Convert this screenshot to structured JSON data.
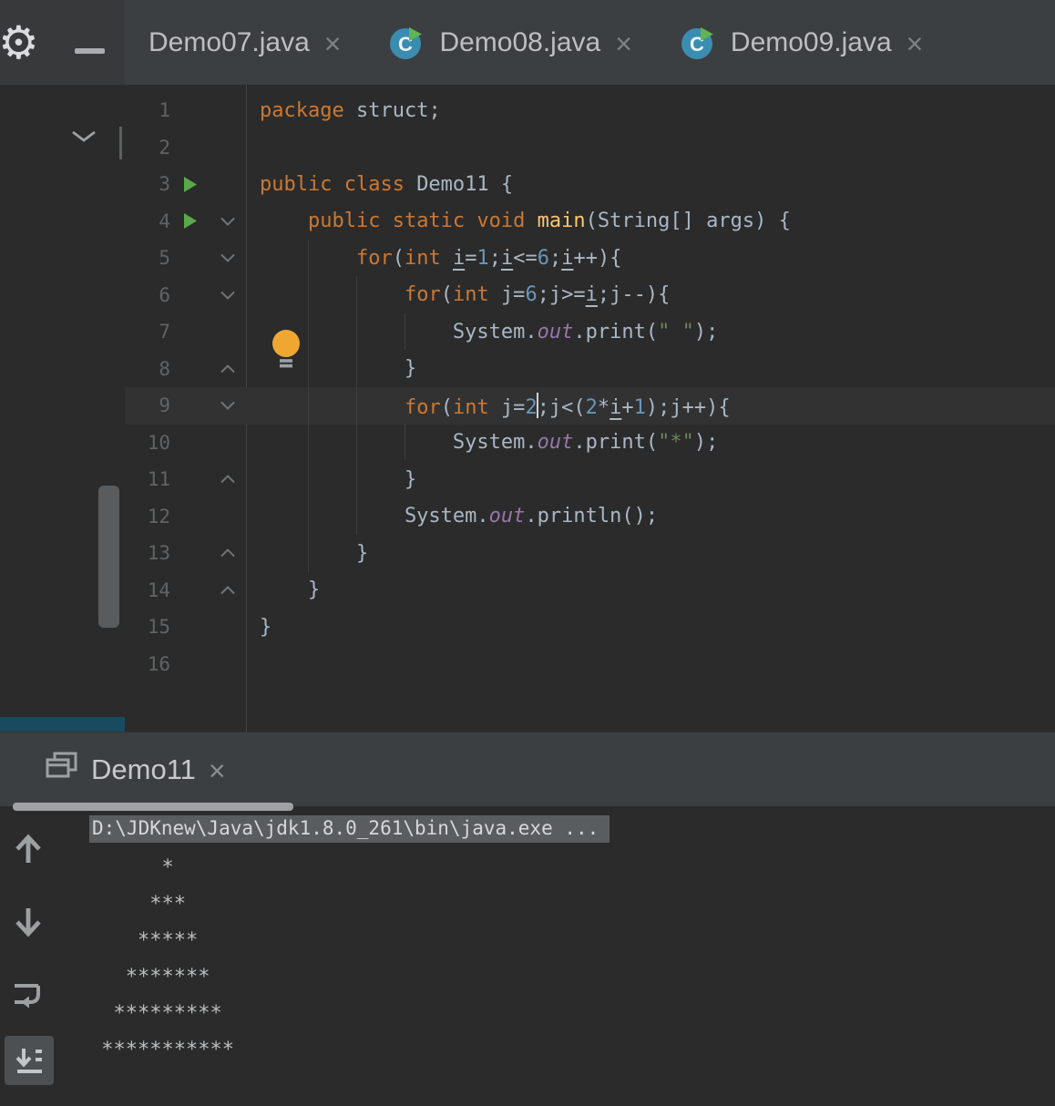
{
  "colors": {
    "keyword": "#cc7832",
    "plain": "#a9b7c6",
    "number": "#6897bb",
    "string": "#6a8759",
    "field": "#9876aa",
    "method": "#ffc66b",
    "line_number": "#606366",
    "editor_bg": "#2b2b2b",
    "caret_line_bg": "#323232",
    "tab_bar_bg": "#3c3f41",
    "panel_bg": "#3c3f41",
    "sidebar_accent": "#1a4a5f",
    "run_green": "#5ba74b",
    "class_icon_teal": "#3a8db0"
  },
  "titlebar": {
    "gear_glyph": "⚙"
  },
  "tabs": [
    {
      "label": "Demo07.java",
      "close_glyph": "×",
      "has_class_icon": false
    },
    {
      "label": "Demo08.java",
      "close_glyph": "×",
      "has_class_icon": true,
      "class_icon_letter": "C"
    },
    {
      "label": "Demo09.java",
      "close_glyph": "×",
      "has_class_icon": true,
      "class_icon_letter": "C"
    }
  ],
  "editor": {
    "lines": [
      {
        "n": 1,
        "t": [
          [
            "k",
            "package "
          ],
          [
            "p",
            "struct;"
          ]
        ]
      },
      {
        "n": 2,
        "t": []
      },
      {
        "n": 3,
        "run": true,
        "t": [
          [
            "k",
            "public class "
          ],
          [
            "p",
            "Demo11 {"
          ]
        ]
      },
      {
        "n": 4,
        "run": true,
        "fold": "down",
        "t": [
          [
            "p",
            "    "
          ],
          [
            "k",
            "public static void "
          ],
          [
            "m",
            "main"
          ],
          [
            "p",
            "(String[] args) {"
          ]
        ]
      },
      {
        "n": 5,
        "fold": "down",
        "t": [
          [
            "p",
            "        "
          ],
          [
            "k",
            "for"
          ],
          [
            "p",
            "("
          ],
          [
            "k",
            "int "
          ],
          [
            "u",
            "i"
          ],
          [
            "p",
            "="
          ],
          [
            "n",
            "1"
          ],
          [
            "p",
            ";"
          ],
          [
            "u",
            "i"
          ],
          [
            "p",
            "<="
          ],
          [
            "n",
            "6"
          ],
          [
            "p",
            ";"
          ],
          [
            "u",
            "i"
          ],
          [
            "p",
            "++){"
          ]
        ]
      },
      {
        "n": 6,
        "fold": "down",
        "t": [
          [
            "p",
            "            "
          ],
          [
            "k",
            "for"
          ],
          [
            "p",
            "("
          ],
          [
            "k",
            "int "
          ],
          [
            "p",
            "j="
          ],
          [
            "n",
            "6"
          ],
          [
            "p",
            ";j>="
          ],
          [
            "u",
            "i"
          ],
          [
            "p",
            ";j--){"
          ]
        ]
      },
      {
        "n": 7,
        "t": [
          [
            "p",
            "                System."
          ],
          [
            "f",
            "out"
          ],
          [
            "p",
            ".print("
          ],
          [
            "s",
            "\" \""
          ],
          [
            "p",
            ");"
          ]
        ]
      },
      {
        "n": 8,
        "fold": "up",
        "t": [
          [
            "p",
            "            }"
          ]
        ]
      },
      {
        "n": 9,
        "fold": "down",
        "current": true,
        "t": [
          [
            "p",
            "            "
          ],
          [
            "k",
            "for"
          ],
          [
            "p",
            "("
          ],
          [
            "k",
            "int "
          ],
          [
            "p",
            "j="
          ],
          [
            "n",
            "2"
          ],
          [
            "caret",
            ""
          ],
          [
            "p",
            ";j<("
          ],
          [
            "n",
            "2"
          ],
          [
            "p",
            "*"
          ],
          [
            "u",
            "i"
          ],
          [
            "p",
            "+"
          ],
          [
            "n",
            "1"
          ],
          [
            "p",
            ");j++){"
          ]
        ]
      },
      {
        "n": 10,
        "t": [
          [
            "p",
            "                System."
          ],
          [
            "f",
            "out"
          ],
          [
            "p",
            ".print("
          ],
          [
            "s",
            "\"*\""
          ],
          [
            "p",
            ");"
          ]
        ]
      },
      {
        "n": 11,
        "fold": "up",
        "t": [
          [
            "p",
            "            }"
          ]
        ]
      },
      {
        "n": 12,
        "t": [
          [
            "p",
            "            System."
          ],
          [
            "f",
            "out"
          ],
          [
            "p",
            ".println();"
          ]
        ]
      },
      {
        "n": 13,
        "fold": "up",
        "t": [
          [
            "p",
            "        }"
          ]
        ]
      },
      {
        "n": 14,
        "fold": "up",
        "t": [
          [
            "p",
            "    }"
          ]
        ]
      },
      {
        "n": 15,
        "t": [
          [
            "p",
            "}"
          ]
        ]
      },
      {
        "n": 16,
        "t": []
      }
    ]
  },
  "run_panel": {
    "tab": {
      "label": "Demo11",
      "close_glyph": "×"
    },
    "console": {
      "command_line": "D:\\JDKnew\\Java\\jdk1.8.0_261\\bin\\java.exe ...",
      "output_lines": [
        "      *",
        "     ***",
        "    *****",
        "   *******",
        "  *********",
        " ***********"
      ]
    }
  }
}
